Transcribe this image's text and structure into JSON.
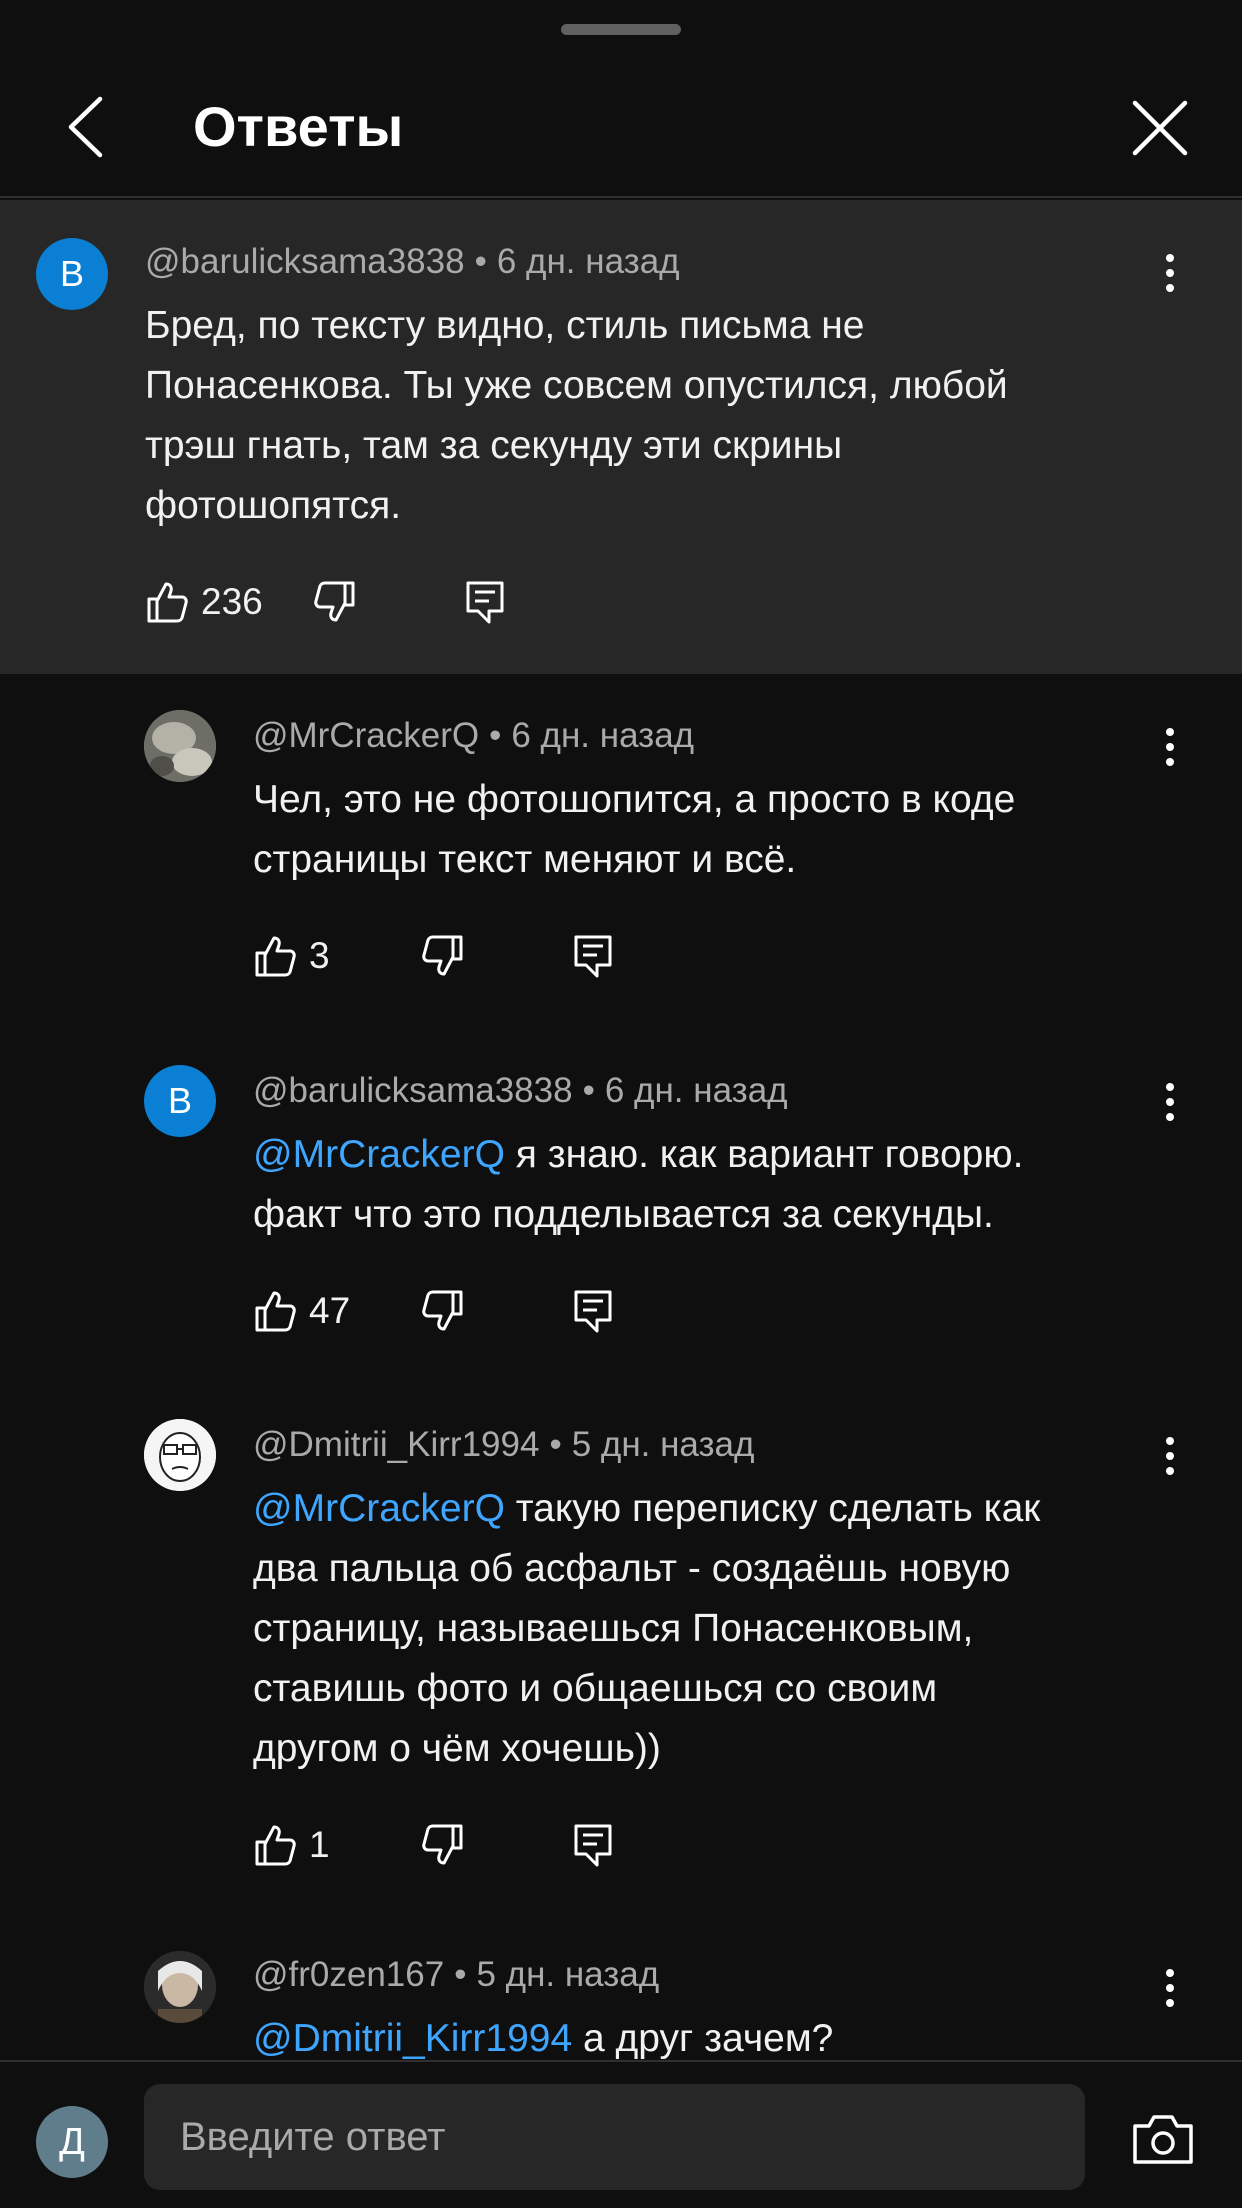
{
  "header": {
    "title": "Ответы"
  },
  "comments": [
    {
      "avatar_letter": "B",
      "author": "@barulicksama3838",
      "time": "6 дн. назад",
      "lines": [
        "Бред, по тексту видно, стиль письма не",
        "Понасенкова. Ты уже совсем опустился, любой",
        "трэш гнать, там за секунду эти скрины",
        "фотошопятся."
      ],
      "likes": "236"
    },
    {
      "author": "@MrCrackerQ",
      "time": "6 дн. назад",
      "lines": [
        "Чел, это не фотошопится, а просто в коде",
        "страницы текст меняют и всё."
      ],
      "likes": "3"
    },
    {
      "avatar_letter": "B",
      "author": "@barulicksama3838",
      "time": "6 дн. назад",
      "mention": "@MrCrackerQ",
      "lines": [
        " я знаю. как вариант говорю.",
        "факт что это подделывается за секунды."
      ],
      "likes": "47"
    },
    {
      "author": "@Dmitrii_Kirr1994",
      "time": "5 дн. назад",
      "mention": "@MrCrackerQ",
      "lines": [
        " такую переписку сделать как",
        "два пальца об асфальт - создаёшь новую",
        "страницу, называешься Понасенковым,",
        "ставишь фото и общаешься со своим",
        "другом о чём хочешь))"
      ],
      "likes": "1"
    },
    {
      "author": "@fr0zen167",
      "time": "5 дн. назад",
      "mention": "@Dmitrii_Kirr1994",
      "lines": [
        " а друг зачем?"
      ]
    }
  ],
  "footer": {
    "user_avatar_letter": "Д",
    "reply_placeholder": "Введите ответ"
  },
  "colors": {
    "background": "#0f0f0f",
    "highlight": "#272727",
    "mention": "#3ea6ff",
    "avatar_blue": "#0b7fd3"
  },
  "icons": [
    "chevron-left-icon",
    "close-icon",
    "thumb-up-icon",
    "thumb-down-icon",
    "reply-icon",
    "more-vert-icon",
    "camera-icon"
  ]
}
